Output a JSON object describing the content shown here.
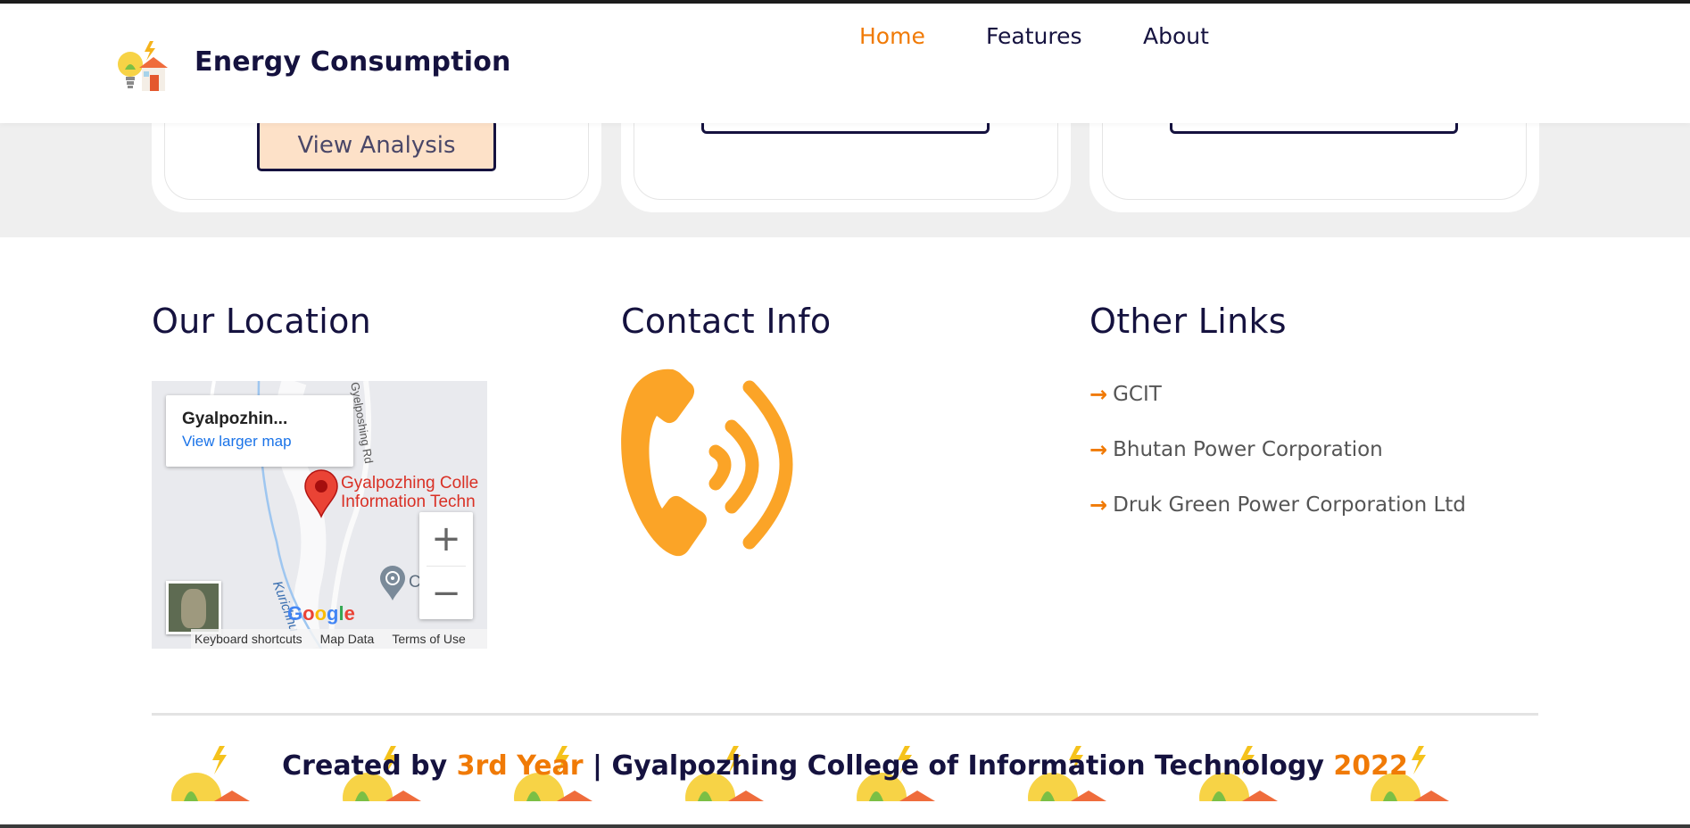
{
  "header": {
    "brand": "Energy Consumption",
    "nav": [
      {
        "label": "Home",
        "active": true
      },
      {
        "label": "Features",
        "active": false
      },
      {
        "label": "About",
        "active": false
      }
    ]
  },
  "cards": {
    "analysis_button": "View Analysis"
  },
  "location": {
    "title": "Our Location",
    "map": {
      "place_short": "Gyalpozhin...",
      "larger_map_link": "View larger map",
      "place_label_line1": "Gyalpozhing Colle",
      "place_label_line2": "Information Techn",
      "road_label": "Gyelposhing Rd",
      "river_label": "Kurichhu",
      "poi_letter": "C",
      "zoom_in": "+",
      "zoom_out": "−",
      "footer": {
        "shortcuts": "Keyboard shortcuts",
        "map_data": "Map Data",
        "terms": "Terms of Use"
      }
    }
  },
  "contact": {
    "title": "Contact Info",
    "icon": "phone-ringing-icon"
  },
  "links": {
    "title": "Other Links",
    "items": [
      "GCIT",
      "Bhutan Power Corporation",
      "Druk Green Power Corporation Ltd"
    ]
  },
  "footer": {
    "prefix": "Created by ",
    "year_group": "3rd Year",
    "middle": " | Gyalpozhing College of Information Technology ",
    "year": "2022"
  },
  "colors": {
    "accent": "#f07a06",
    "navy": "#15123f",
    "phone_icon": "#fba427"
  }
}
